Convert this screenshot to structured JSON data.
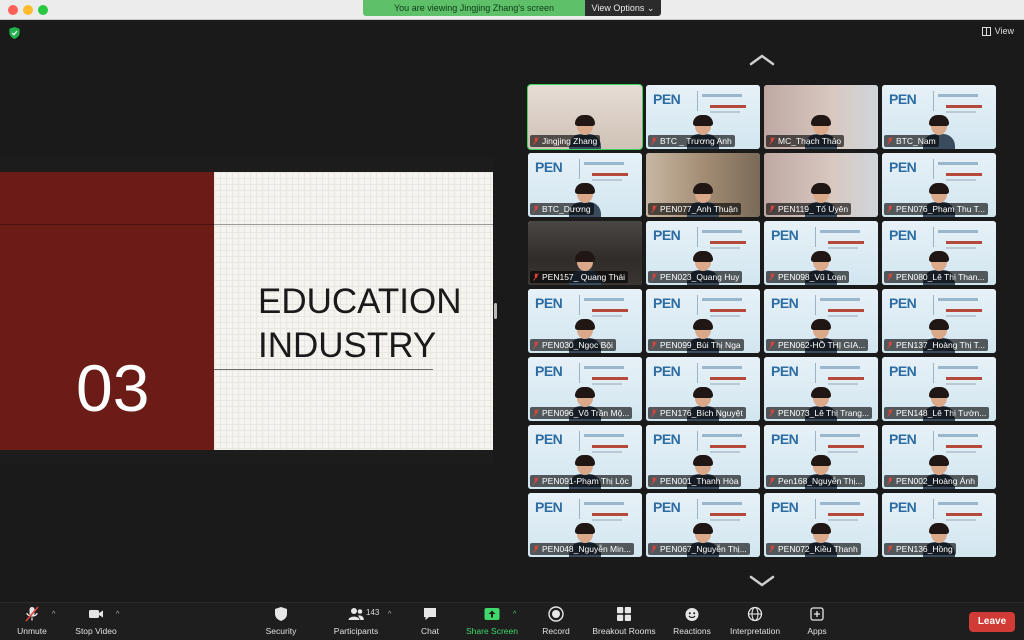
{
  "banner": {
    "viewing_text": "You are viewing Jingjing Zhang's screen",
    "view_options": "View Options ⌄"
  },
  "top_right": {
    "view_label": "View"
  },
  "slide": {
    "number": "03",
    "title_line1": "EDUCATION",
    "title_line2": "INDUSTRY",
    "colors": {
      "left_panel": "#6b1c17",
      "right_panel": "#f6f4f0"
    }
  },
  "gallery": {
    "tiles": [
      {
        "name": "Jingjing Zhang",
        "kind": "cam",
        "active": true
      },
      {
        "name": "BTC _ Trương Anh",
        "kind": "pen"
      },
      {
        "name": "MC_Thạch Thảo",
        "kind": "cam"
      },
      {
        "name": "BTC_Nam",
        "kind": "pen"
      },
      {
        "name": "BTC_Dương",
        "kind": "pen"
      },
      {
        "name": "PEN077_Anh Thuận",
        "kind": "cam"
      },
      {
        "name": "PEN119_ Tố Uyên",
        "kind": "cam"
      },
      {
        "name": "PEN076_Phạm Thu T...",
        "kind": "pen"
      },
      {
        "name": "PEN157_ Quang Thái",
        "kind": "dark"
      },
      {
        "name": "PEN023_Quang Huy",
        "kind": "pen"
      },
      {
        "name": "PEN098_Vũ Loan",
        "kind": "pen"
      },
      {
        "name": "PEN080_Lê Thị Than...",
        "kind": "pen"
      },
      {
        "name": "PEN030_Ngọc Bội",
        "kind": "pen"
      },
      {
        "name": "PEN099_Bùi Thị Nga",
        "kind": "pen"
      },
      {
        "name": "PEN062-HỒ THỊ GIA...",
        "kind": "pen"
      },
      {
        "name": "PEN137_Hoàng Thị T...",
        "kind": "pen"
      },
      {
        "name": "PEN096_Võ Trần Mộ...",
        "kind": "pen"
      },
      {
        "name": "PEN176_Bích Nguyệt",
        "kind": "pen"
      },
      {
        "name": "PEN073_Lê Thị Trang...",
        "kind": "pen"
      },
      {
        "name": "PEN148_Lê Thị Tườn...",
        "kind": "pen"
      },
      {
        "name": "PEN091-Phạm Thị Lộc",
        "kind": "pen"
      },
      {
        "name": "PEN001_Thanh Hòa",
        "kind": "pen"
      },
      {
        "name": "Pen168_Nguyễn Thị...",
        "kind": "pen"
      },
      {
        "name": "PEN002_Hoàng Ánh",
        "kind": "pen"
      },
      {
        "name": "PEN048_Nguyễn Min...",
        "kind": "pen"
      },
      {
        "name": "PEN067_Nguyễn Thị...",
        "kind": "pen"
      },
      {
        "name": "PEN072_Kiều Thanh",
        "kind": "pen"
      },
      {
        "name": "PEN136_Hồng",
        "kind": "pen"
      }
    ],
    "pen_logo_text": "PEN"
  },
  "toolbar": {
    "unmute": "Unmute",
    "stop_video": "Stop Video",
    "security": "Security",
    "participants": "Participants",
    "participants_count": "143",
    "chat": "Chat",
    "share_screen": "Share Screen",
    "record": "Record",
    "breakout_rooms": "Breakout Rooms",
    "reactions": "Reactions",
    "interpretation": "Interpretation",
    "apps": "Apps",
    "leave": "Leave",
    "colors": {
      "share": "#3fd96a",
      "leave": "#d03b35"
    }
  }
}
